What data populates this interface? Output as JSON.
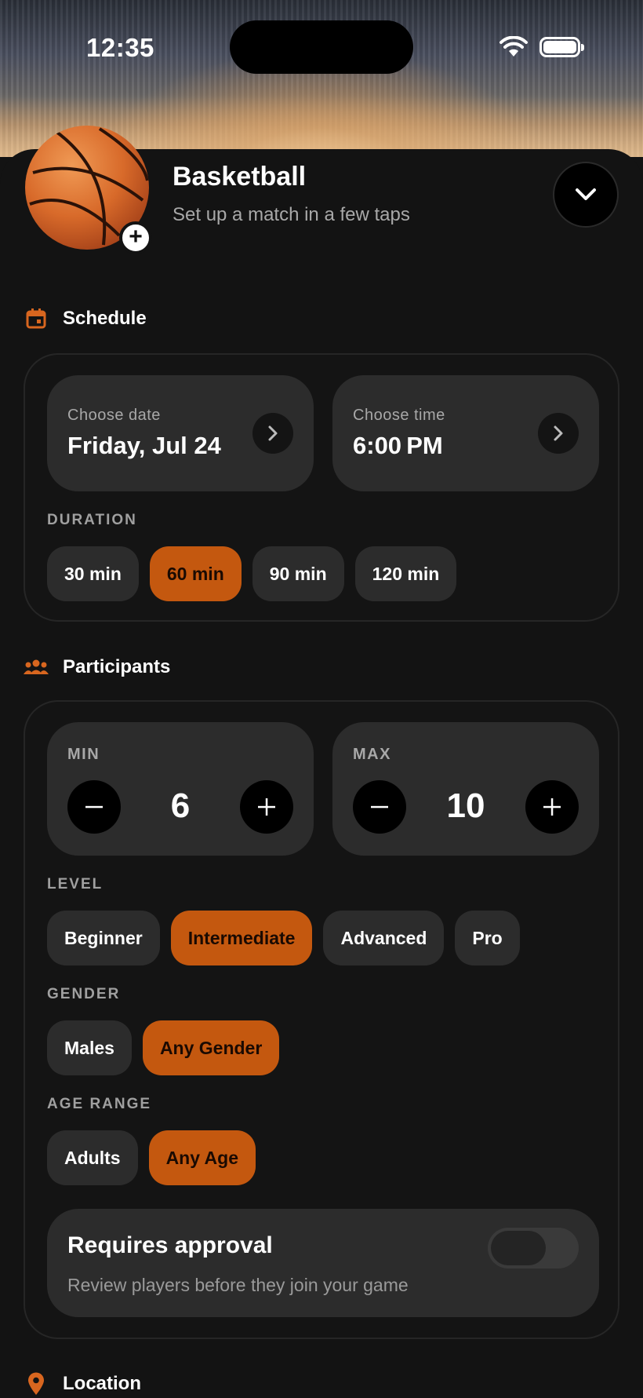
{
  "status_bar": {
    "time": "12:35"
  },
  "header": {
    "title": "Basketball",
    "subtitle": "Set up a match in a few taps"
  },
  "schedule": {
    "section_label": "Schedule",
    "date": {
      "caption": "Choose date",
      "value": "Friday, Jul 24"
    },
    "time": {
      "caption": "Choose time",
      "value": "6:00 PM"
    },
    "duration": {
      "label": "DURATION",
      "options": [
        "30 min",
        "60 min",
        "90 min",
        "120 min"
      ],
      "selected": "60 min"
    }
  },
  "participants": {
    "section_label": "Participants",
    "min": {
      "caption": "MIN",
      "value": 6
    },
    "max": {
      "caption": "MAX",
      "value": 10
    },
    "level": {
      "label": "LEVEL",
      "options": [
        "Beginner",
        "Intermediate",
        "Advanced",
        "Pro"
      ],
      "selected": "Intermediate"
    },
    "gender": {
      "label": "GENDER",
      "options": [
        "Males",
        "Any Gender"
      ],
      "selected": "Any Gender"
    },
    "age_range": {
      "label": "AGE RANGE",
      "options": [
        "Adults",
        "Any Age"
      ],
      "selected": "Any Age"
    },
    "approval": {
      "title": "Requires approval",
      "description": "Review players before they join your game",
      "enabled": false
    }
  },
  "location": {
    "section_label": "Location"
  },
  "colors": {
    "accent": "#c4580f",
    "background": "#131313",
    "surface": "#2c2c2c"
  }
}
